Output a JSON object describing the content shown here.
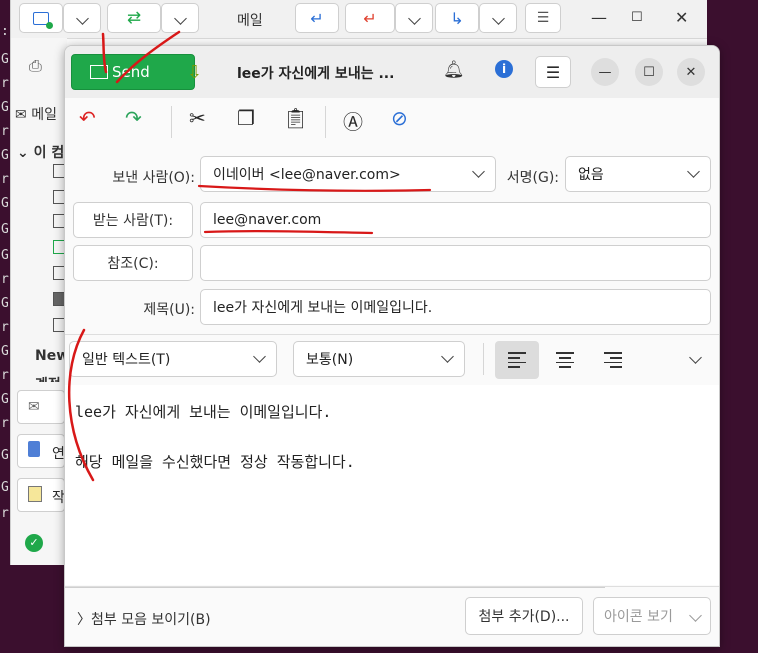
{
  "background": {
    "terminal_glyphs": [
      ":",
      "G",
      "r",
      "G",
      "r",
      "G",
      "r",
      "G",
      "G",
      "G",
      "r",
      "G",
      "r",
      "G",
      "r",
      "G",
      "r",
      "G",
      "G",
      "r"
    ],
    "main_window": {
      "title": "메일",
      "sidebar": {
        "mail_label": "메일",
        "folder_group": "이 컴",
        "new_label": "New",
        "extra_label": "계정",
        "tab_contacts": "연",
        "tab_tasks": "작"
      }
    }
  },
  "compose": {
    "send_label": "Send",
    "title": "lee가 자신에게 보내는 ...",
    "from_label": "보낸 사람(O):",
    "from_value": "이네이버 <lee@naver.com>",
    "signature_label": "서명(G):",
    "signature_value": "없음",
    "to_label": "받는 사람(T):",
    "to_value": "lee@naver.com",
    "cc_label": "참조(C):",
    "cc_value": "",
    "subject_label": "제목(U):",
    "subject_value": "lee가 자신에게 보내는 이메일입니다.",
    "format_value": "일반 텍스트(T)",
    "paragraph_value": "보통(N)",
    "body_lines": [
      "lee가 자신에게 보내는 이메일입니다.",
      "해당 메일을 수신했다면 정상 작동합니다."
    ],
    "attach_toggle": "〉첨부 모음 보이기(B)",
    "attach_add": "첨부 추가(D)...",
    "icon_view": "아이콘 보기"
  },
  "colors": {
    "send_green": "#1fa84a",
    "annotation_red": "#d81818",
    "desktop": "#3b0f2e"
  },
  "icons": [
    "compose-mail-icon",
    "sync-icon",
    "reply-icon",
    "reply-all-icon",
    "forward-icon",
    "menu-icon",
    "download-icon",
    "bell-icon",
    "info-icon",
    "undo-icon",
    "redo-icon",
    "cut-icon",
    "copy-icon",
    "paste-icon",
    "spellcheck-icon",
    "spellcheck-live-icon",
    "align-left-icon",
    "align-center-icon",
    "align-right-icon"
  ]
}
